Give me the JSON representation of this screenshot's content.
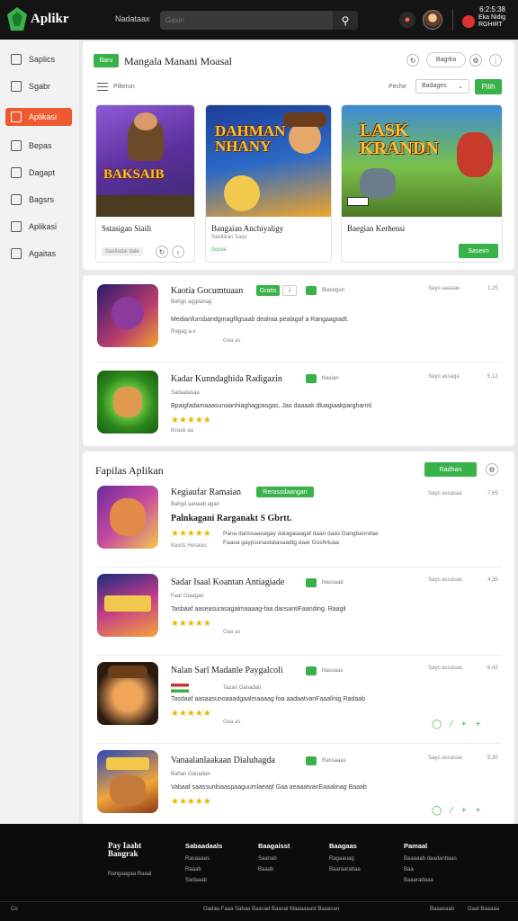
{
  "header": {
    "logo_text": "Aplikr",
    "nav_link": "Nadataax",
    "search_placeholder": "Gaxin",
    "clock": "6:2:5:38",
    "user_label": "Eka Nidig RGHIRT"
  },
  "sidebar": {
    "items": [
      {
        "label": "Saplics",
        "icon": "grid-icon",
        "active": false
      },
      {
        "label": "Sgabr",
        "icon": "gamepad-icon",
        "active": false
      },
      {
        "label": "Aplikasi",
        "icon": "apps-icon",
        "active": true
      },
      {
        "label": "Bepas",
        "icon": "document-icon",
        "active": false
      },
      {
        "label": "Dagapt",
        "icon": "download-icon",
        "active": false
      },
      {
        "label": "Bagsrs",
        "icon": "book-icon",
        "active": false
      },
      {
        "label": "Aplikasi",
        "icon": "phone-icon",
        "active": false
      },
      {
        "label": "Agaitas",
        "icon": "user-icon",
        "active": false
      }
    ]
  },
  "featured": {
    "tag": "Baru",
    "title": "Mangala Manani Moasal",
    "pill_label": "Bagrka",
    "sort_label": "Pilterun",
    "sort_by_label": "Peche",
    "sort_value": "Badages",
    "filter_button": "Pilih",
    "tiles": [
      {
        "art_text": "BAKSAIB",
        "title": "Sstasigan Siaili",
        "subtitle": "Saeiladai dale",
        "button": ""
      },
      {
        "art_text": "DAHMAN NHANY",
        "title": "Bangaian Anchiyaligy",
        "subtitle": "Saeilikan Saaz",
        "link": "Sosse"
      },
      {
        "art_text": "LASK KRANDN",
        "title": "Baegian Kerhensi",
        "subtitle": "",
        "button": "Saseim"
      }
    ]
  },
  "list_top": {
    "rows": [
      {
        "title": "Kaotia Gocumtuaan",
        "badge": "Gratis",
        "version": "Blasegun",
        "meta": "Bahgn aggitanag",
        "desc": "Medianfunsbandgmagfilgsaab dealraa pealagaf a Rangaagradt.",
        "rating_text": "Ragag a-s",
        "dl": "Gaa as",
        "date": "Sayo aaaaao",
        "size": "1,25"
      },
      {
        "title": "Kadar Kunndaghida Radigazin",
        "badge": "",
        "version": "Nasian",
        "meta": "Sadaalasaa",
        "desc": "Bpaigfadamaaasunaanhiaghagpasgas, Jao daaaak dluagiaakpargharnti",
        "rating_text": "",
        "dl": "Bvaak aa",
        "date": "Sayo assaga",
        "size": "5,12"
      }
    ]
  },
  "list_main": {
    "title": "Fapilas Aplikan",
    "button": "Radhan",
    "rows": [
      {
        "title": "Kegiaufar Ramaian",
        "badge": "Rerassdaangan",
        "meta": "Bahgd aanaab agan",
        "subtitle": "Palnkagani Rarganakt S Gbrtt.",
        "desc": "Pana danssaasagay dalagaiaagaf daan daas Dangbanndae",
        "desc2": "Faaoa gaypsunastatasaadtg daar Goshrtuaa",
        "dl": "Bavds Hesaias",
        "date": "Sayo assasaa",
        "size": "7,65"
      },
      {
        "title": "Sadar Isaal Koantan Antiagiade",
        "badge": "",
        "version": "Nassaab",
        "meta": "Faar Giaagan",
        "desc": "Tasbaaf aaseasurasagalmaaaag-faa dansantiFaanding. Raagil",
        "dl": "Gaa as",
        "date": "Sayo assasaa",
        "size": "4,35"
      },
      {
        "title": "Nalan Sarl Madanle Paygalcoli",
        "badge": "",
        "version": "Nassaas",
        "meta": "Tazan Ganadan",
        "desc": "Tasdaaf aasaasunoaaadgaalmaaaag foa aadaatvanFaaalinig Radaab",
        "dl": "Gaa as",
        "date": "Sayo assasaa",
        "size": "6,42"
      },
      {
        "title": "Vanaalanlaakaan Dialuhagda",
        "badge": "",
        "version": "Rassaaas",
        "meta": "Bahan Ganadan",
        "desc": "Vabaaf saassunbiaaspaaguumlaeaqf Gaa aeaaatvanEaaalinag Baaab",
        "dl": "",
        "date": "Sayo assasaa",
        "size": "5,30"
      }
    ]
  },
  "footer": {
    "brand": "Pay Iaaht Bangrak",
    "brand_sub": "Rangaagaa Raaal",
    "columns": [
      {
        "title": "Sabaadaals",
        "items": [
          "Rasaaaas",
          "Raaab",
          "Sadaaab"
        ]
      },
      {
        "title": "Baagaisst",
        "items": [
          "Saanab",
          "Baaab"
        ]
      },
      {
        "title": "Baagaas",
        "items": [
          "Ragaauag",
          "Baaraarabaa"
        ]
      },
      {
        "title": "Pamaal",
        "items": [
          "Baaaaab daadanbaas",
          "Baa",
          "Baaaradaaa"
        ]
      }
    ],
    "bottom_left": "Co",
    "bottom_center": "Gadaa Faaa Sabaa Baasad Baasai Maaaaaast Baaasan",
    "bottom_right_1": "Baaasaab",
    "bottom_right_2": "Gaal Baaaaa"
  },
  "colors": {
    "accent": "#3ab24a",
    "active_nav": "#ee5a2f",
    "header_bg": "#141414"
  }
}
